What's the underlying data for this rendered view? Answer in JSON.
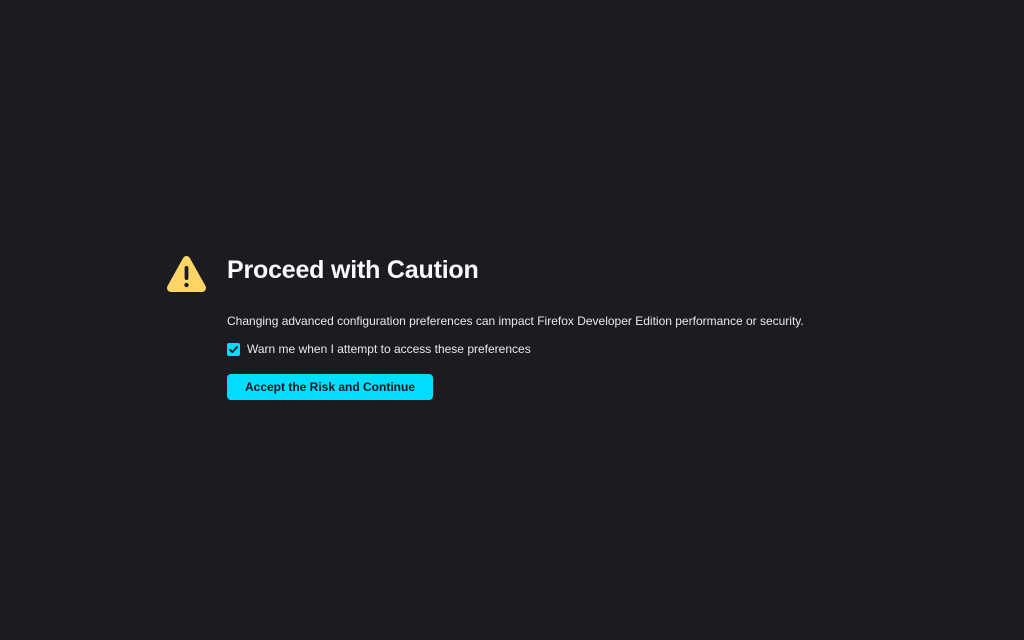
{
  "warning": {
    "icon": "warning-triangle-icon",
    "color": "#ffd567"
  },
  "title": "Proceed with Caution",
  "description": "Changing advanced configuration preferences can impact Firefox Developer Edition performance or security.",
  "checkbox": {
    "label": "Warn me when I attempt to access these preferences",
    "checked": true,
    "color": "#00ddff"
  },
  "button": {
    "label": "Accept the Risk and Continue",
    "color": "#00ddff"
  },
  "theme": {
    "background": "#1c1b22",
    "text": "#fbfbfe"
  }
}
